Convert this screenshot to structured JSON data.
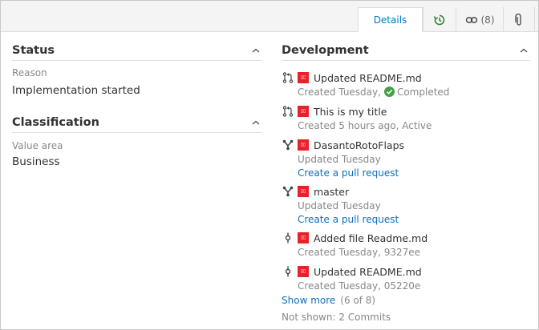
{
  "tabs": {
    "details": "Details",
    "links_count": "(8)"
  },
  "status": {
    "title": "Status",
    "reason_label": "Reason",
    "reason_value": "Implementation started"
  },
  "classification": {
    "title": "Classification",
    "value_area_label": "Value area",
    "value_area_value": "Business"
  },
  "development": {
    "title": "Development",
    "items": [
      {
        "name": "Updated README.md",
        "meta": "Created Tuesday,",
        "status": "Completed"
      },
      {
        "name": "This is my title",
        "meta": "Created 5 hours ago, Active"
      },
      {
        "name": "DasantoRotoFlaps",
        "meta": "Updated Tuesday",
        "link": "Create a pull request"
      },
      {
        "name": "master",
        "meta": "Updated Tuesday",
        "link": "Create a pull request"
      },
      {
        "name": "Added file Readme.md",
        "meta": "Created Tuesday, 9327ee"
      },
      {
        "name": "Updated README.md",
        "meta": "Created Tuesday, 05220e"
      }
    ],
    "show_more": "Show more",
    "show_more_count": "(6 of 8)",
    "not_shown": "Not shown: 2 Commits"
  },
  "colors": {
    "accent": "#007acc",
    "link": "#106ebe",
    "repo_red": "#e8202a",
    "completed_green": "#43a047"
  },
  "icons": [
    "history-icon",
    "link-icon",
    "attachment-icon",
    "chevron-up-icon",
    "pull-request-icon",
    "branch-icon",
    "commit-icon",
    "repo-icon",
    "check-icon"
  ]
}
